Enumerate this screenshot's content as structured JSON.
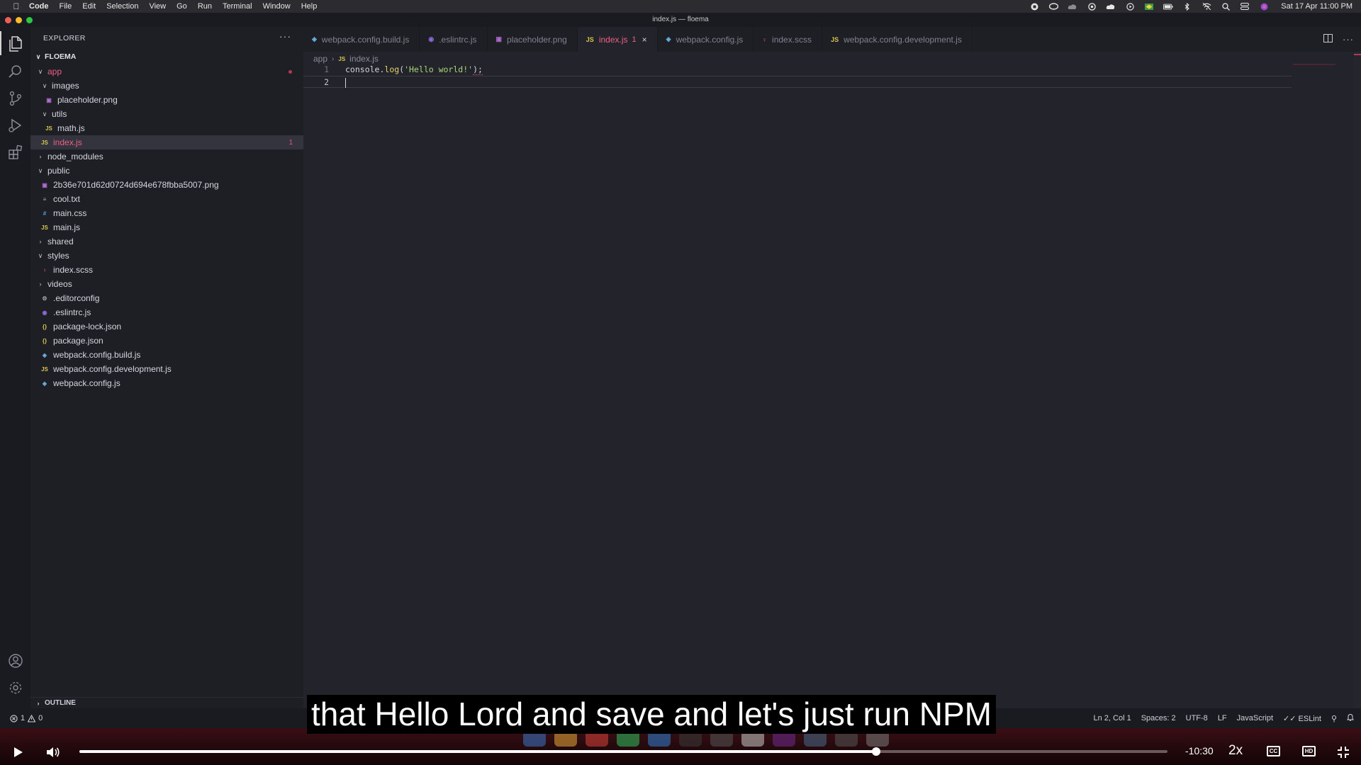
{
  "menubar": {
    "app_name": "Code",
    "menus": [
      "File",
      "Edit",
      "Selection",
      "View",
      "Go",
      "Run",
      "Terminal",
      "Window",
      "Help"
    ],
    "clock": "Sat 17 Apr  11:00 PM"
  },
  "window": {
    "title": "index.js — floema"
  },
  "sidebar": {
    "header": "EXPLORER",
    "more": "···",
    "project": "FLOEMA",
    "tree": [
      {
        "label": "app",
        "type": "folder",
        "open": true,
        "depth": 0,
        "status": "error"
      },
      {
        "label": "images",
        "type": "folder",
        "open": true,
        "depth": 1
      },
      {
        "label": "placeholder.png",
        "type": "file",
        "icon": "image",
        "depth": 2
      },
      {
        "label": "utils",
        "type": "folder",
        "open": true,
        "depth": 1
      },
      {
        "label": "math.js",
        "type": "file",
        "icon": "js",
        "depth": 2
      },
      {
        "label": "index.js",
        "type": "file",
        "icon": "js",
        "depth": 1,
        "selected": true,
        "errors": "1"
      },
      {
        "label": "node_modules",
        "type": "folder",
        "open": false,
        "depth": 0
      },
      {
        "label": "public",
        "type": "folder",
        "open": true,
        "depth": 0
      },
      {
        "label": "2b36e701d62d0724d694e678fbba5007.png",
        "type": "file",
        "icon": "image",
        "depth": 1
      },
      {
        "label": "cool.txt",
        "type": "file",
        "icon": "text",
        "depth": 1
      },
      {
        "label": "main.css",
        "type": "file",
        "icon": "css",
        "depth": 1
      },
      {
        "label": "main.js",
        "type": "file",
        "icon": "js",
        "depth": 1
      },
      {
        "label": "shared",
        "type": "folder",
        "open": false,
        "depth": 0
      },
      {
        "label": "styles",
        "type": "folder",
        "open": true,
        "depth": 0
      },
      {
        "label": "index.scss",
        "type": "file",
        "icon": "scss",
        "depth": 1
      },
      {
        "label": "videos",
        "type": "folder",
        "open": false,
        "depth": 0
      },
      {
        "label": ".editorconfig",
        "type": "file",
        "icon": "gear",
        "depth": 0
      },
      {
        "label": ".eslintrc.js",
        "type": "file",
        "icon": "eslint",
        "depth": 0
      },
      {
        "label": "package-lock.json",
        "type": "file",
        "icon": "json",
        "depth": 0
      },
      {
        "label": "package.json",
        "type": "file",
        "icon": "json",
        "depth": 0
      },
      {
        "label": "webpack.config.build.js",
        "type": "file",
        "icon": "webpack",
        "depth": 0
      },
      {
        "label": "webpack.config.development.js",
        "type": "file",
        "icon": "js",
        "depth": 0
      },
      {
        "label": "webpack.config.js",
        "type": "file",
        "icon": "webpack",
        "depth": 0
      }
    ],
    "outline": "OUTLINE"
  },
  "editor": {
    "tabs": [
      {
        "label": "webpack.config.build.js",
        "icon": "webpack"
      },
      {
        "label": ".eslintrc.js",
        "icon": "eslint"
      },
      {
        "label": "placeholder.png",
        "icon": "image"
      },
      {
        "label": "index.js",
        "icon": "js",
        "active": true,
        "badge": "1",
        "close": "×"
      },
      {
        "label": "webpack.config.js",
        "icon": "webpack"
      },
      {
        "label": "index.scss",
        "icon": "scss"
      },
      {
        "label": "webpack.config.development.js",
        "icon": "js"
      }
    ],
    "breadcrumb": {
      "folder": "app",
      "file": "index.js"
    },
    "lines": [
      {
        "num": "1",
        "obj": "console",
        "dot": ".",
        "fn": "log",
        "open": "(",
        "str": "'Hello world!'",
        "close": ");"
      },
      {
        "num": "2"
      }
    ]
  },
  "statusbar": {
    "errors": "1",
    "warnings": "0",
    "position": "Ln 2, Col 1",
    "spaces": "Spaces: 2",
    "encoding": "UTF-8",
    "eol": "LF",
    "language": "JavaScript",
    "linter": "ESLint"
  },
  "player": {
    "caption": "that Hello Lord and save and let's just run NPM",
    "time_remaining": "-10:30",
    "speed": "2x",
    "cc_label": "CC",
    "hd_label": "HD",
    "progress": 0.732
  },
  "colors": {
    "accent_error": "#ef5f83",
    "js_icon": "#d6c44f",
    "folder_open_active": "#ef5f83"
  }
}
